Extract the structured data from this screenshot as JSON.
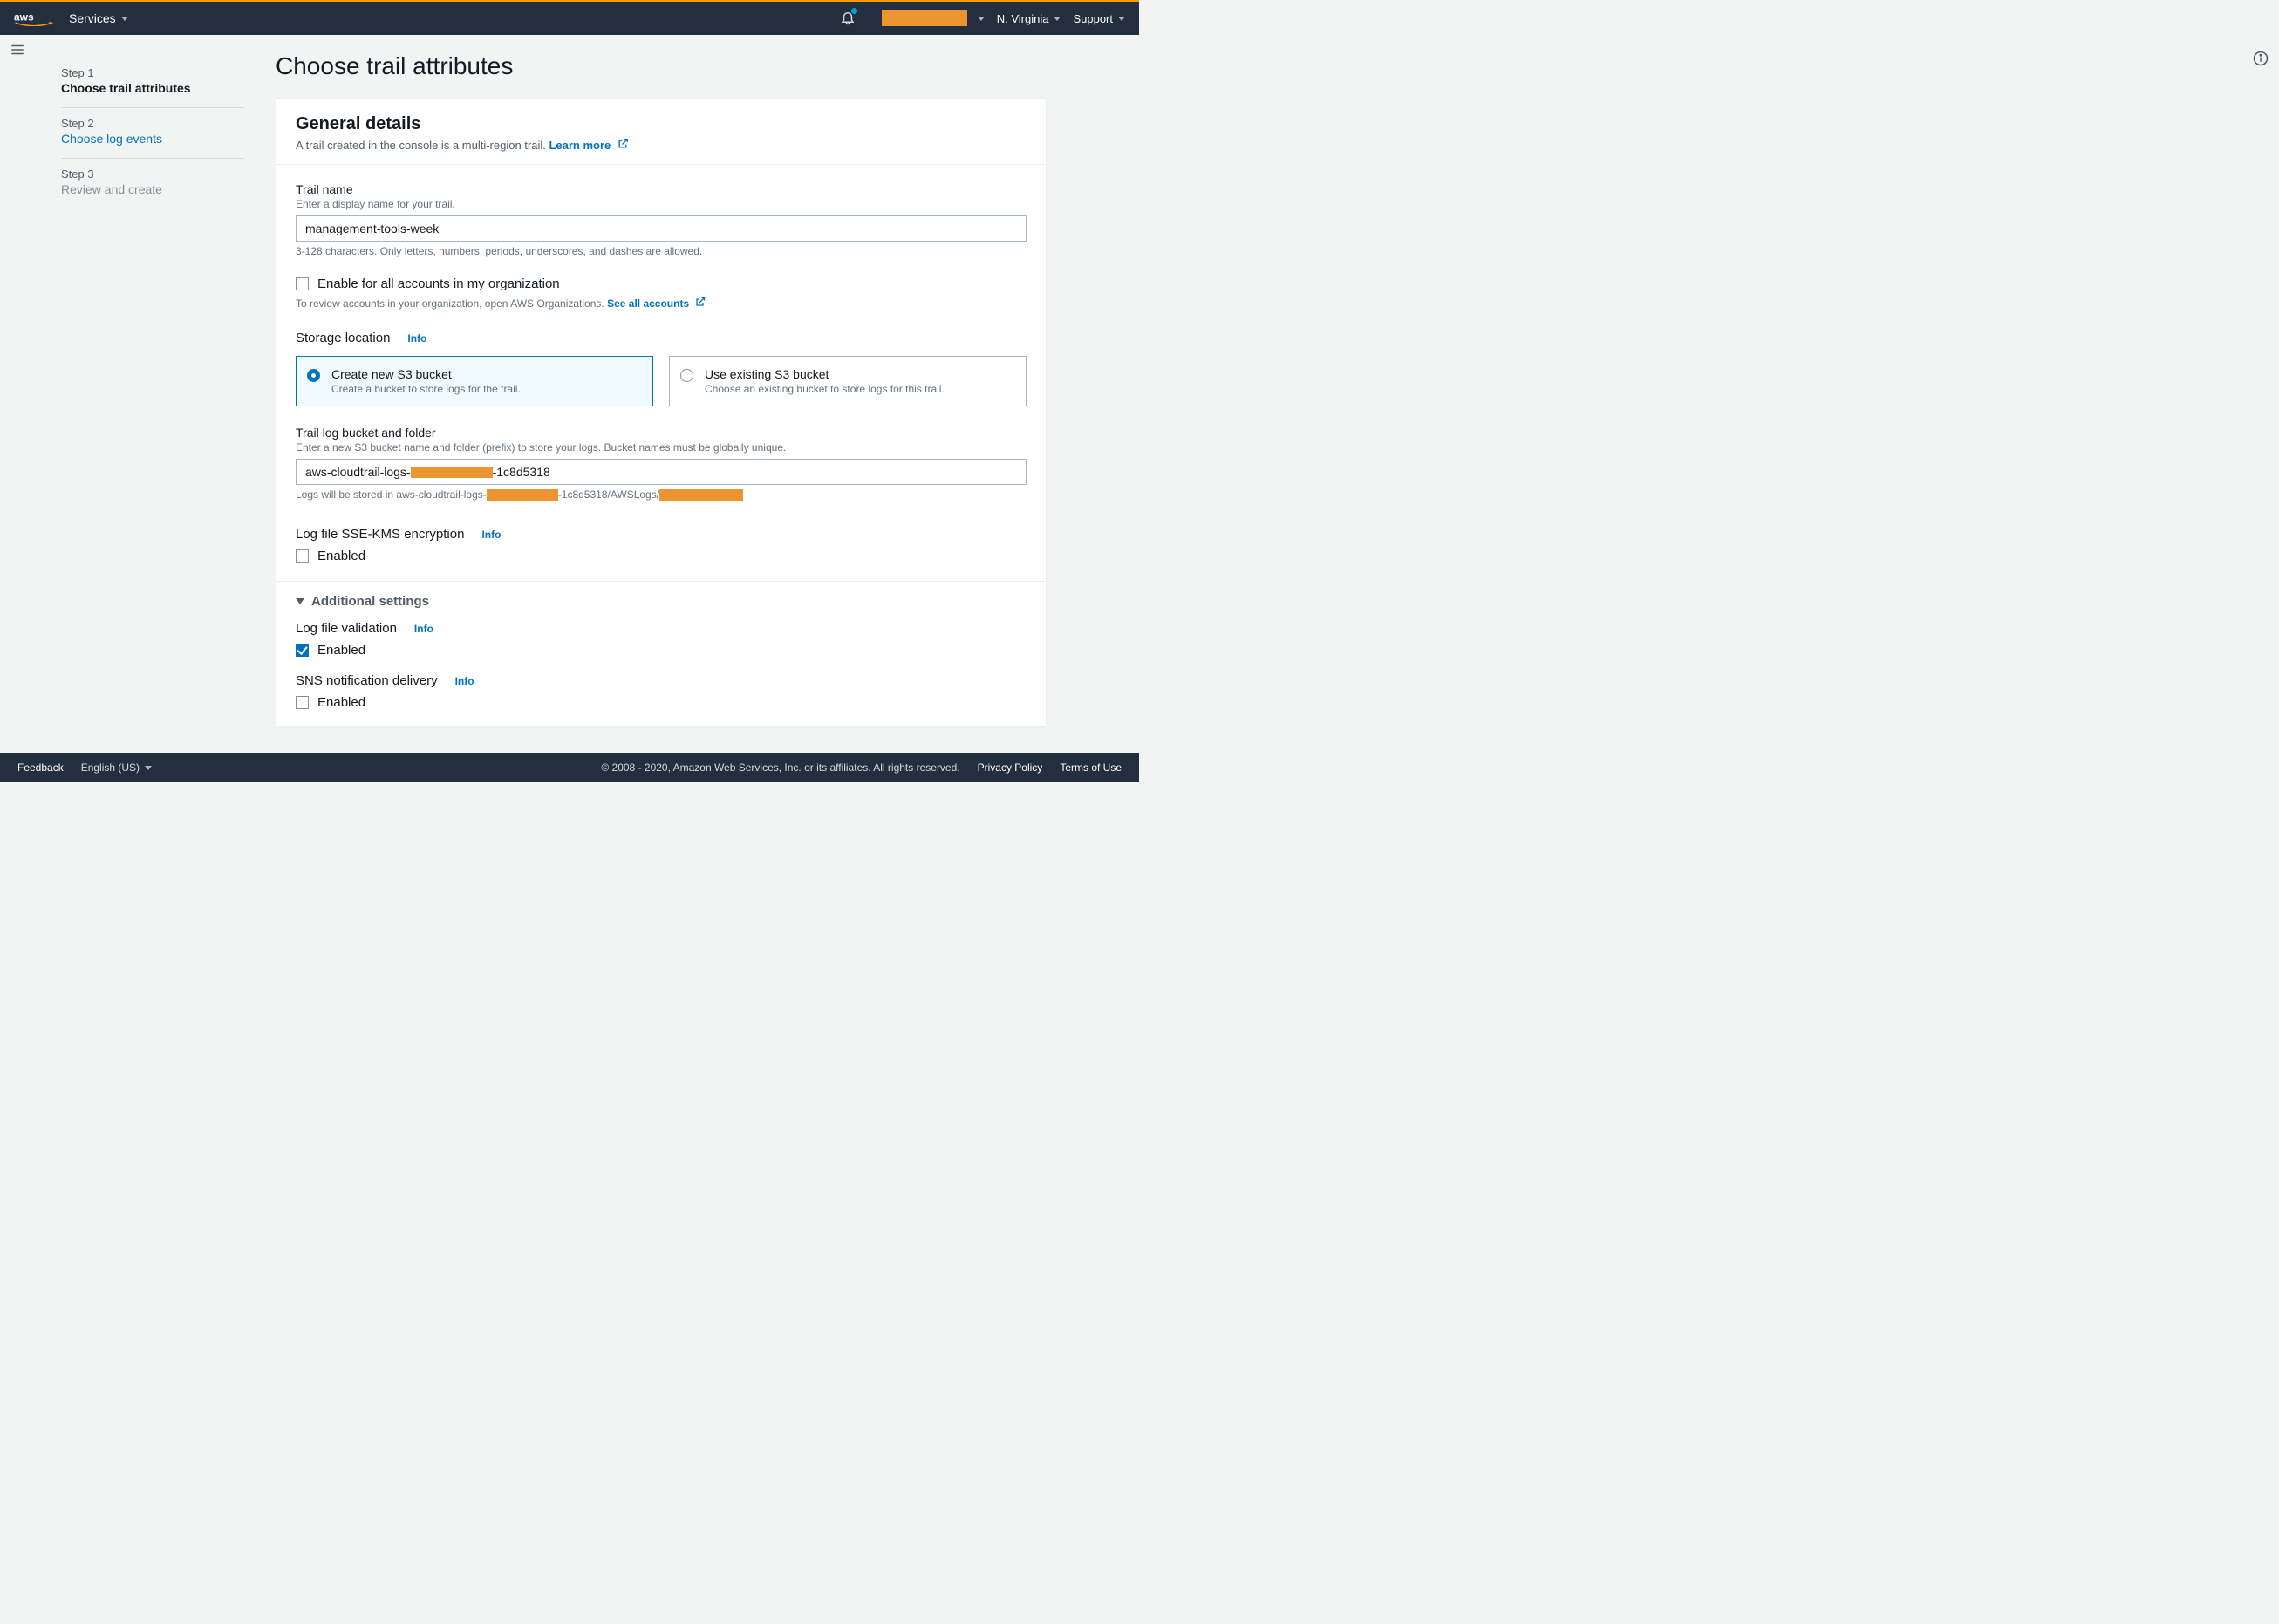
{
  "topbar": {
    "services": "Services",
    "region": "N. Virginia",
    "support": "Support"
  },
  "steps": {
    "s1_label": "Step 1",
    "s1_title": "Choose trail attributes",
    "s2_label": "Step 2",
    "s2_title": "Choose log events",
    "s3_label": "Step 3",
    "s3_title": "Review and create"
  },
  "page_title": "Choose trail attributes",
  "panel": {
    "title": "General details",
    "subtitle_pre": "A trail created in the console is a multi-region trail. ",
    "learn_more": "Learn more"
  },
  "trail_name": {
    "label": "Trail name",
    "hint": "Enter a display name for your trail.",
    "value": "management-tools-week",
    "help": "3-128 characters. Only letters, numbers, periods, underscores, and dashes are allowed."
  },
  "org": {
    "check_label": "Enable for all accounts in my organization",
    "help_pre": "To review accounts in your organization, open AWS Organizations. ",
    "see_all": "See all accounts"
  },
  "storage": {
    "label": "Storage location",
    "info": "Info",
    "opt1_title": "Create new S3 bucket",
    "opt1_sub": "Create a bucket to store logs for the trail.",
    "opt2_title": "Use existing S3 bucket",
    "opt2_sub": "Choose an existing bucket to store logs for this trail."
  },
  "bucket": {
    "label": "Trail log bucket and folder",
    "hint": "Enter a new S3 bucket name and folder (prefix) to store your logs. Bucket names must be globally unique.",
    "value_prefix": "aws-cloudtrail-logs-",
    "value_suffix": "-1c8d5318",
    "stored_pre": "Logs will be stored in aws-cloudtrail-logs-",
    "stored_mid": "1c8d5318/AWSLogs/"
  },
  "kms": {
    "label": "Log file SSE-KMS encryption",
    "info": "Info",
    "enabled_label": "Enabled"
  },
  "additional": {
    "title": "Additional settings",
    "validation_label": "Log file validation",
    "info": "Info",
    "enabled_label": "Enabled",
    "sns_label": "SNS notification delivery"
  },
  "footer": {
    "feedback": "Feedback",
    "language": "English (US)",
    "copyright": "© 2008 - 2020, Amazon Web Services, Inc. or its affiliates. All rights reserved.",
    "privacy": "Privacy Policy",
    "terms": "Terms of Use"
  }
}
